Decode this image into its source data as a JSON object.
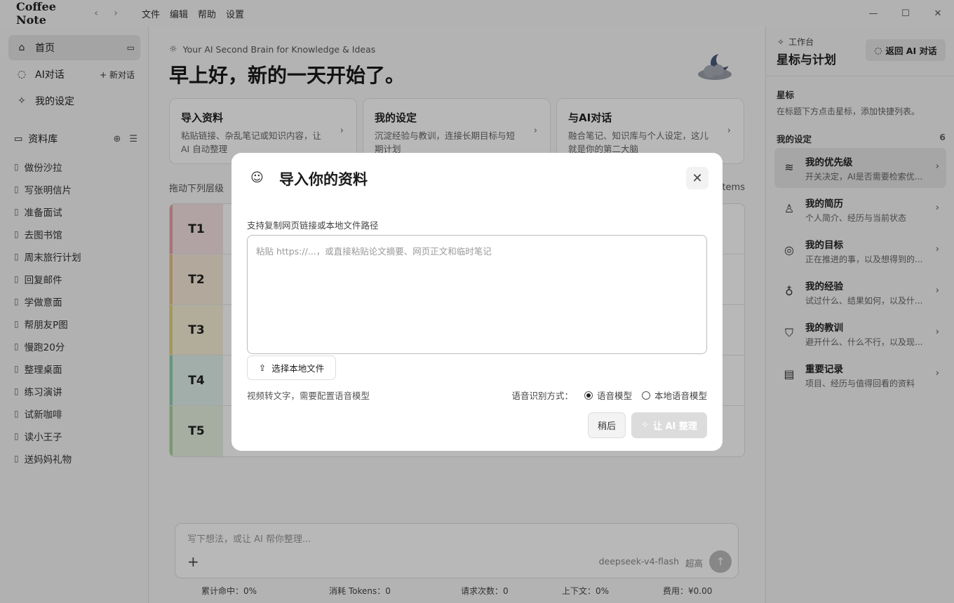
{
  "titlebar": {
    "app_name": "Coffee Note",
    "menu": [
      "文件",
      "编辑",
      "帮助",
      "设置"
    ]
  },
  "sidebar": {
    "home": "首页",
    "ai_chat": "AI对话",
    "new_chat": "新对话",
    "settings": "我的设定",
    "library": "资料库",
    "library_items": [
      "做份沙拉",
      "写张明信片",
      "准备面试",
      "去图书馆",
      "周末旅行计划",
      "回复邮件",
      "学做意面",
      "帮朋友P图",
      "慢跑20分",
      "整理桌面",
      "练习演讲",
      "试新咖啡",
      "读小王子",
      "送妈妈礼物"
    ]
  },
  "main": {
    "tagline": "Your AI Second Brain for Knowledge & Ideas",
    "greeting": "早上好，新的一天开始了。",
    "cards": [
      {
        "title": "导入资料",
        "desc": "粘贴链接、杂乱笔记或知识内容，让 AI 自动整理"
      },
      {
        "title": "我的设定",
        "desc": "沉淀经验与教训，连接长期目标与短期计划"
      },
      {
        "title": "与AI对话",
        "desc": "融合笔记、知识库与个人设定，这儿就是你的第二大脑"
      }
    ],
    "tier_hint": "拖动下列层级",
    "items_label": "items",
    "tiers": [
      "T1",
      "T2",
      "T3",
      "T4",
      "T5"
    ],
    "tier_colors": [
      "#e8a0a8",
      "#e8c08a",
      "#e6d27a",
      "#8ecfb0",
      "#a8d59a"
    ],
    "chat_placeholder": "写下想法，或让 AI 帮你整理...",
    "model": "deepseek-v4-flash",
    "quality": "超高",
    "stats": [
      "累计命中：0%",
      "消耗 Tokens：0",
      "请求次数：0",
      "上下文：0%",
      "费用：¥0.00"
    ]
  },
  "right_panel": {
    "label": "工作台",
    "title": "星标与计划",
    "back_button": "返回 AI 对话",
    "star_heading": "星标",
    "star_desc": "在标题下方点击星标，添加快捷列表。",
    "mine_heading": "我的设定",
    "mine_count": "6",
    "items": [
      {
        "title": "我的优先级",
        "desc": "开关决定，AI是否需要检索优...",
        "icon": "layers-icon"
      },
      {
        "title": "我的简历",
        "desc": "个人简介、经历与当前状态",
        "icon": "user-icon"
      },
      {
        "title": "我的目标",
        "desc": "正在推进的事，以及想得到的...",
        "icon": "target-icon"
      },
      {
        "title": "我的经验",
        "desc": "试过什么、结果如何，以及什...",
        "icon": "bulb-icon"
      },
      {
        "title": "我的教训",
        "desc": "避开什么、什么不行，以及现...",
        "icon": "shield-icon"
      },
      {
        "title": "重要记录",
        "desc": "项目、经历与值得回看的资料",
        "icon": "archive-icon"
      }
    ]
  },
  "modal": {
    "title": "导入你的资料",
    "label": "支持复制网页链接或本地文件路径",
    "placeholder": "粘贴 https://...，或直接粘贴论文摘要、网页正文和临时笔记",
    "file_button": "选择本地文件",
    "video_hint": "视频转文字，需要配置语音模型",
    "asr_label": "语音识别方式：",
    "asr_options": [
      "语音模型",
      "本地语音模型"
    ],
    "asr_selected": "语音模型",
    "later_button": "稍后",
    "ai_button": "让 AI 整理"
  }
}
